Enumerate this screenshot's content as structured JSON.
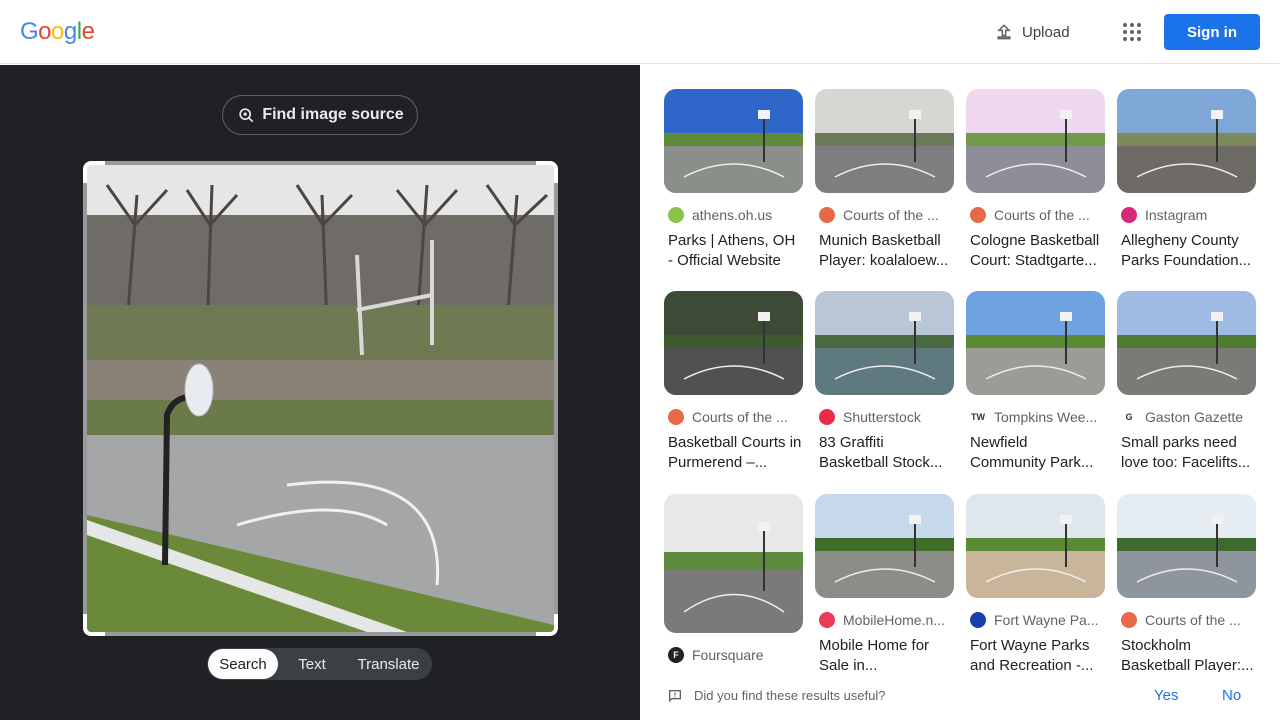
{
  "header": {
    "logo_letters": [
      "G",
      "o",
      "o",
      "g",
      "l",
      "e"
    ],
    "logo_colors": [
      "#4285f4",
      "#ea4335",
      "#fbbc05",
      "#4285f4",
      "#34a853",
      "#ea4335"
    ],
    "upload_label": "Upload",
    "apps_icon": "apps-grid-icon",
    "signin_label": "Sign in"
  },
  "lens": {
    "find_source_label": "Find image source",
    "modes": [
      "Search",
      "Text",
      "Translate"
    ],
    "active_mode": "Search"
  },
  "results": [
    {
      "source": "athens.oh.us",
      "title": "Parks | Athens, OH - Official Website",
      "favicon_color": "#8bc34a",
      "favicon_text": "",
      "sky": "#2f66c9",
      "ground": "#8a8f8a",
      "grass": "#5f8a3a"
    },
    {
      "source": "Courts of the ...",
      "title": "Munich Basketball Player: koalaloew...",
      "favicon_color": "#e8684a",
      "favicon_text": "",
      "sky": "#d8d6d2",
      "ground": "#7e7e80",
      "grass": "#6b7a58"
    },
    {
      "source": "Courts of the ...",
      "title": "Cologne Basketball Court: Stadtgarte...",
      "favicon_color": "#e8684a",
      "favicon_text": "",
      "sky": "#efd8ef",
      "ground": "#8e8e98",
      "grass": "#6f9b4a"
    },
    {
      "source": "Instagram",
      "title": "Allegheny County Parks Foundation...",
      "favicon_color": "#d62976",
      "favicon_text": "",
      "sky": "#7ea7d8",
      "ground": "#6e6a66",
      "grass": "#7d8a5a"
    },
    {
      "source": "Courts of the ...",
      "title": "Basketball Courts in Purmerend –...",
      "favicon_color": "#e8684a",
      "favicon_text": "",
      "sky": "#3c4a36",
      "ground": "#4f5250",
      "grass": "#3f5a2e"
    },
    {
      "source": "Shutterstock",
      "title": "83 Graffiti Basketball Stock...",
      "favicon_color": "#ee2b47",
      "favicon_text": "",
      "sky": "#b9c6d6",
      "ground": "#5f7a7e",
      "grass": "#4a6b42"
    },
    {
      "source": "Tompkins Wee...",
      "title": "Newfield Community Park...",
      "favicon_color": "#ffffff",
      "favicon_text": "TW",
      "sky": "#6ea2e0",
      "ground": "#9a9c96",
      "grass": "#5a8a36"
    },
    {
      "source": "Gaston Gazette",
      "title": "Small parks need love too: Facelifts...",
      "favicon_color": "#ffffff",
      "favicon_text": "G",
      "sky": "#9dbbe3",
      "ground": "#7a7a76",
      "grass": "#4e7c30"
    },
    {
      "source": "Foursquare",
      "title": "",
      "favicon_color": "#222222",
      "favicon_text": "F",
      "sky": "#e8e8e8",
      "ground": "#7a7a7a",
      "grass": "#5e8a3e"
    },
    {
      "source": "MobileHome.n...",
      "title": "Mobile Home for Sale in...",
      "favicon_color": "#ea3c5a",
      "favicon_text": "",
      "sky": "#c8d8ec",
      "ground": "#8c8c88",
      "grass": "#3e6e2a"
    },
    {
      "source": "Fort Wayne Pa...",
      "title": "Fort Wayne Parks and Recreation -...",
      "favicon_color": "#1a3fae",
      "favicon_text": "",
      "sky": "#dfe7ee",
      "ground": "#c9b59a",
      "grass": "#5a8a34"
    },
    {
      "source": "Courts of the ...",
      "title": "Stockholm Basketball Player:...",
      "favicon_color": "#e8684a",
      "favicon_text": "",
      "sky": "#e6edf2",
      "ground": "#8e959c",
      "grass": "#3d6a2e"
    }
  ],
  "feedback": {
    "question": "Did you find these results useful?",
    "yes_label": "Yes",
    "no_label": "No"
  }
}
